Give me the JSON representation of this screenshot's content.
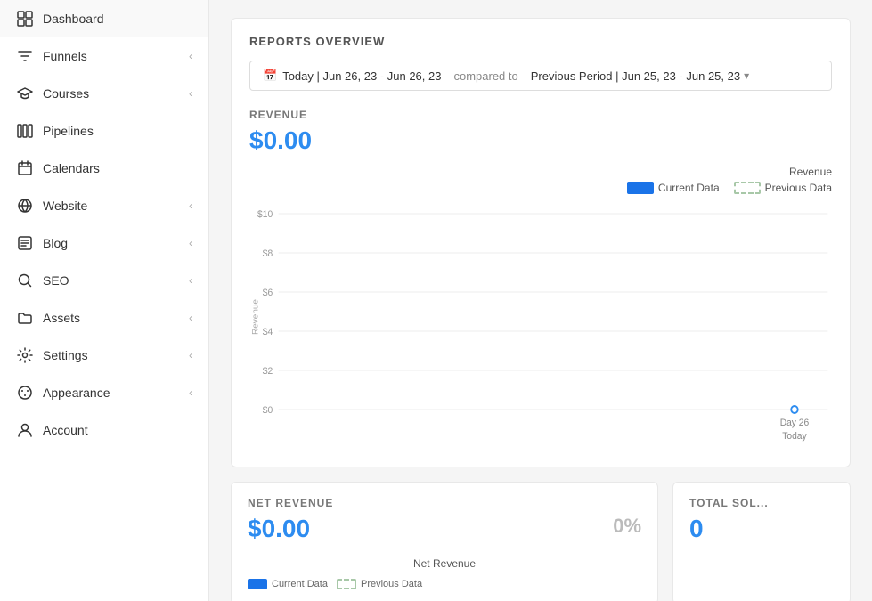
{
  "sidebar": {
    "items": [
      {
        "id": "dashboard",
        "label": "Dashboard",
        "icon": "grid",
        "hasChevron": false
      },
      {
        "id": "funnels",
        "label": "Funnels",
        "icon": "filter",
        "hasChevron": true
      },
      {
        "id": "courses",
        "label": "Courses",
        "icon": "graduation",
        "hasChevron": true
      },
      {
        "id": "pipelines",
        "label": "Pipelines",
        "icon": "grid2",
        "hasChevron": false
      },
      {
        "id": "calendars",
        "label": "Calendars",
        "icon": "calendar",
        "hasChevron": false
      },
      {
        "id": "website",
        "label": "Website",
        "icon": "globe",
        "hasChevron": true
      },
      {
        "id": "blog",
        "label": "Blog",
        "icon": "document",
        "hasChevron": true
      },
      {
        "id": "seo",
        "label": "SEO",
        "icon": "search",
        "hasChevron": true
      },
      {
        "id": "assets",
        "label": "Assets",
        "icon": "folder",
        "hasChevron": true
      },
      {
        "id": "settings",
        "label": "Settings",
        "icon": "gear",
        "hasChevron": true
      },
      {
        "id": "appearance",
        "label": "Appearance",
        "icon": "palette",
        "hasChevron": true
      },
      {
        "id": "account",
        "label": "Account",
        "icon": "user",
        "hasChevron": false
      }
    ]
  },
  "reports": {
    "title": "REPORTS OVERVIEW",
    "compared_to_label": "compared to",
    "date_range": "Today | Jun 26, 23 - Jun 26, 23",
    "period": "Previous Period | Jun 25, 23 - Jun 25, 23",
    "revenue": {
      "title": "REVENUE",
      "value": "$0.00",
      "chart_title": "Revenue",
      "legend_current": "Current Data",
      "legend_previous": "Previous Data",
      "y_axis_label": "Revenue",
      "y_labels": [
        "$10",
        "$8",
        "$6",
        "$4",
        "$2",
        "$0"
      ],
      "x_labels": [
        "Day 26",
        "Today"
      ]
    },
    "net_revenue": {
      "title": "NET REVENUE",
      "value": "$0.00",
      "percent": "0%",
      "chart_title": "Net Revenue",
      "legend_current": "Current Data",
      "legend_previous": "Previous Data"
    },
    "total_sold": {
      "title": "TOTAL SOL...",
      "value": "0"
    }
  }
}
